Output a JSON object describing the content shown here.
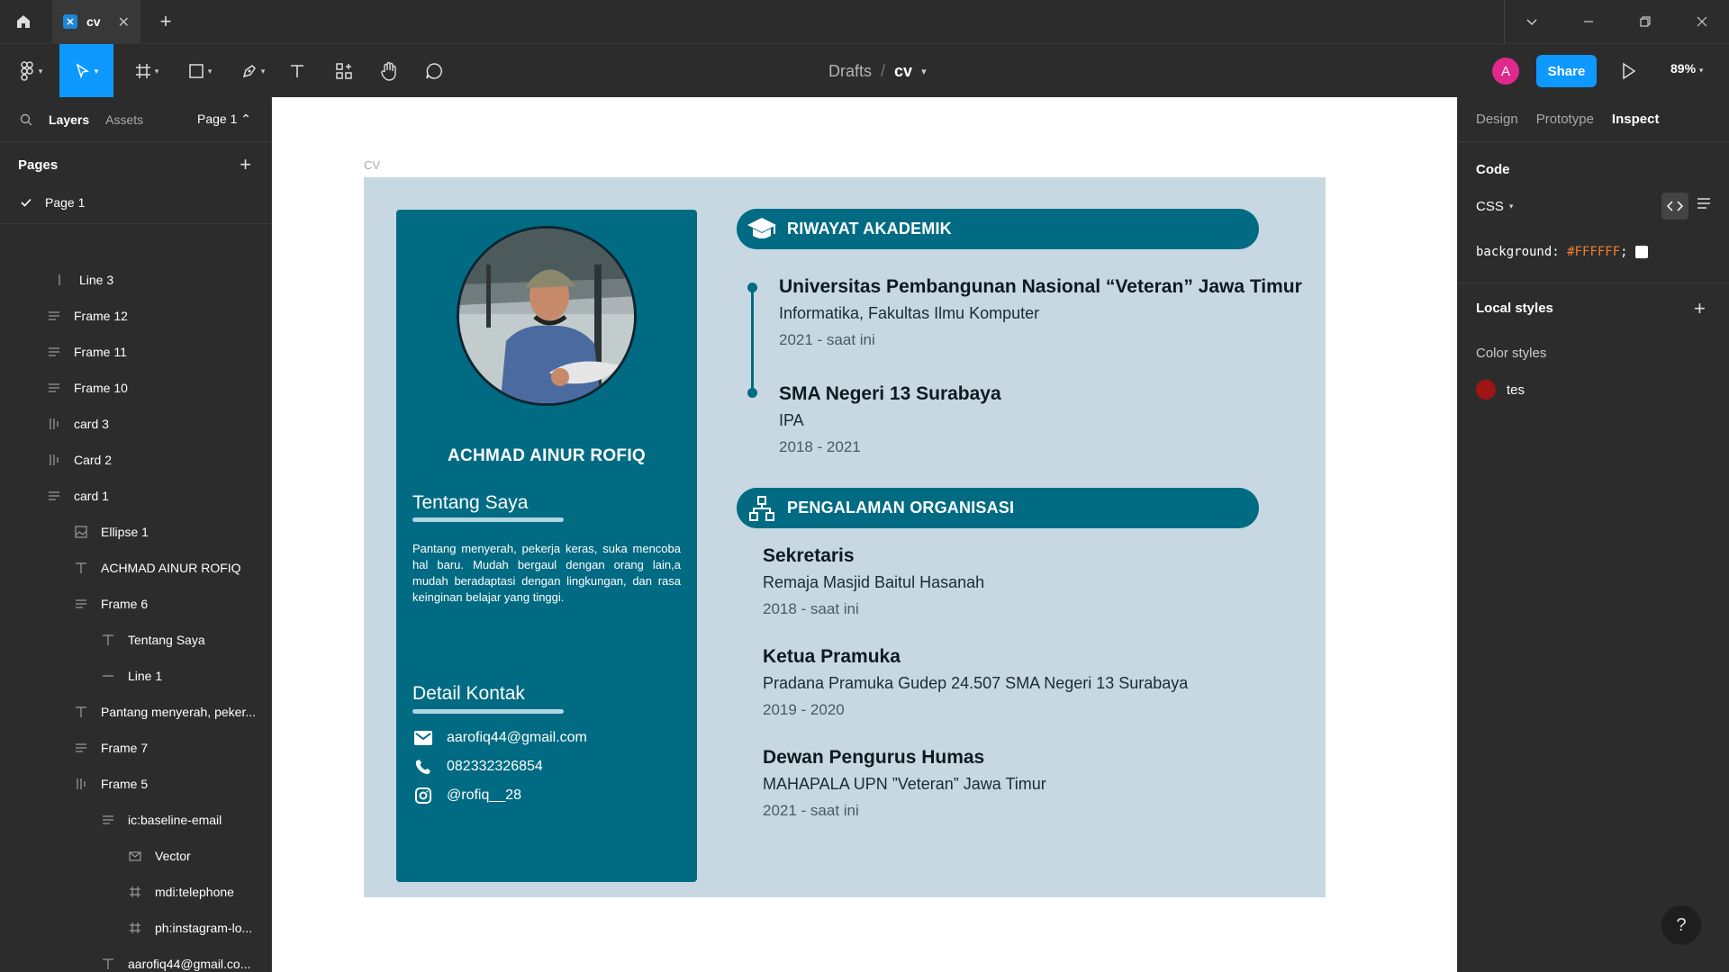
{
  "titlebar": {
    "tab_title": "cv",
    "close_tab": "✕",
    "new_tab": "+"
  },
  "toolbar": {
    "breadcrumb_drafts": "Drafts",
    "breadcrumb_sep": "/",
    "file_name": "cv",
    "avatar_initial": "A",
    "share_label": "Share",
    "zoom": "89%"
  },
  "left_panel": {
    "tab_layers": "Layers",
    "tab_assets": "Assets",
    "page_selector": "Page 1 ⌃",
    "pages_header": "Pages",
    "pages_add": "+",
    "pages": [
      {
        "label": "Page 1",
        "selected": true
      }
    ],
    "layers": [
      {
        "label": "Line 3",
        "icon": "line-vertical"
      },
      {
        "label": "Frame 12",
        "icon": "frame-rows"
      },
      {
        "label": "Frame 11",
        "icon": "frame-rows"
      },
      {
        "label": "Frame 10",
        "icon": "frame-rows"
      },
      {
        "label": "card 3",
        "icon": "frame-columns"
      },
      {
        "label": "Card 2",
        "icon": "frame-columns"
      },
      {
        "label": "card 1",
        "icon": "frame-rows"
      },
      {
        "label": "Ellipse 1",
        "icon": "image"
      },
      {
        "label": "ACHMAD AINUR ROFIQ",
        "icon": "text"
      },
      {
        "label": "Frame 6",
        "icon": "frame-rows"
      },
      {
        "label": "Tentang Saya",
        "icon": "text"
      },
      {
        "label": "Line 1",
        "icon": "line-horizontal"
      },
      {
        "label": "Pantang menyerah, peker...",
        "icon": "text"
      },
      {
        "label": "Frame 7",
        "icon": "frame-rows"
      },
      {
        "label": "Frame 5",
        "icon": "frame-columns"
      },
      {
        "label": "ic:baseline-email",
        "icon": "frame-rows"
      },
      {
        "label": "Vector",
        "icon": "mail"
      },
      {
        "label": "mdi:telephone",
        "icon": "hash"
      },
      {
        "label": "ph:instagram-lo...",
        "icon": "hash"
      },
      {
        "label": "aarofiq44@gmail.co...",
        "icon": "text"
      }
    ]
  },
  "canvas": {
    "frame_label": "CV",
    "left_card": {
      "name": "ACHMAD AINUR ROFIQ",
      "about_title": "Tentang Saya",
      "about_text": "Pantang menyerah, pekerja keras, suka mencoba hal baru. Mudah bergaul dengan orang lain,a mudah beradaptasi dengan lingkungan, dan rasa keinginan belajar yang tinggi.",
      "contact_title": "Detail Kontak",
      "email": "aarofiq44@gmail.com",
      "phone": "082332326854",
      "instagram": "@rofiq__28"
    },
    "academic": {
      "header": "RIWAYAT AKADEMIK",
      "items": [
        {
          "title": "Universitas Pembangunan Nasional “Veteran” Jawa Timur",
          "subtitle": "Informatika, Fakultas Ilmu Komputer",
          "date": "2021 - saat ini"
        },
        {
          "title": "SMA Negeri 13 Surabaya",
          "subtitle": "IPA",
          "date": "2018 - 2021"
        }
      ]
    },
    "organization": {
      "header": "PENGALAMAN ORGANISASI",
      "items": [
        {
          "title": "Sekretaris",
          "subtitle": "Remaja Masjid Baitul Hasanah",
          "date": "2018 - saat ini"
        },
        {
          "title": "Ketua Pramuka",
          "subtitle": "Pradana Pramuka Gudep 24.507 SMA Negeri 13 Surabaya",
          "date": "2019 - 2020"
        },
        {
          "title": "Dewan Pengurus Humas",
          "subtitle": "MAHAPALA UPN ”Veteran” Jawa Timur",
          "date": "2021 - saat ini"
        }
      ]
    }
  },
  "right_panel": {
    "tab_design": "Design",
    "tab_prototype": "Prototype",
    "tab_inspect": "Inspect",
    "code_header": "Code",
    "code_lang": "CSS",
    "code_prop": "background:",
    "code_value": "#FFFFFF",
    "code_end": ";",
    "local_styles": "Local styles",
    "local_styles_add": "+",
    "color_styles": "Color styles",
    "style_name": "tes",
    "style_color": "#9f1515",
    "help": "?"
  },
  "colors": {
    "accent": "#0d99ff",
    "cv_teal": "#006b83",
    "cv_background": "#c7d8e3"
  }
}
